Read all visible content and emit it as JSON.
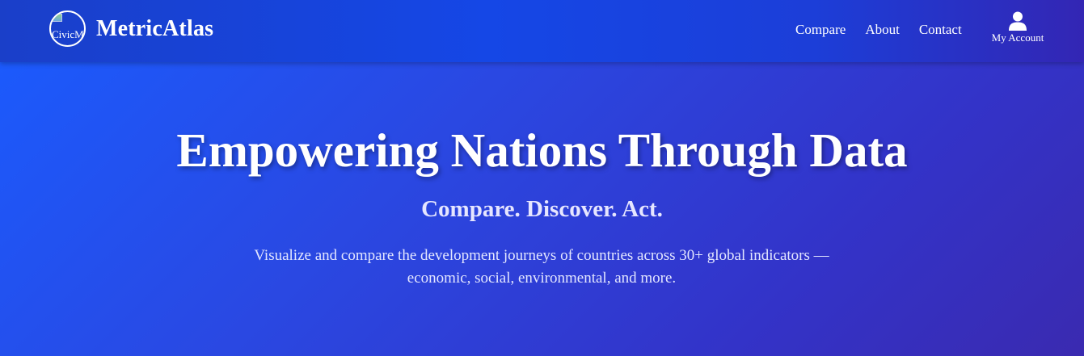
{
  "nav": {
    "logo_alt": "CivicM",
    "brand": "MetricAtlas",
    "links": [
      {
        "label": "Compare"
      },
      {
        "label": "About"
      },
      {
        "label": "Contact"
      }
    ],
    "account_label": "My Account",
    "account_icon": "user-icon"
  },
  "hero": {
    "title": "Empowering Nations Through Data",
    "subtitle": "Compare. Discover. Act.",
    "description": "Visualize and compare the development journeys of countries across 30+ global indicators — economic, social, environmental, and more."
  },
  "colors": {
    "nav_background": "#1547e6",
    "hero_gradient_start": "#1a5cff",
    "hero_gradient_end": "#3a2ab0",
    "text": "#ffffff"
  }
}
